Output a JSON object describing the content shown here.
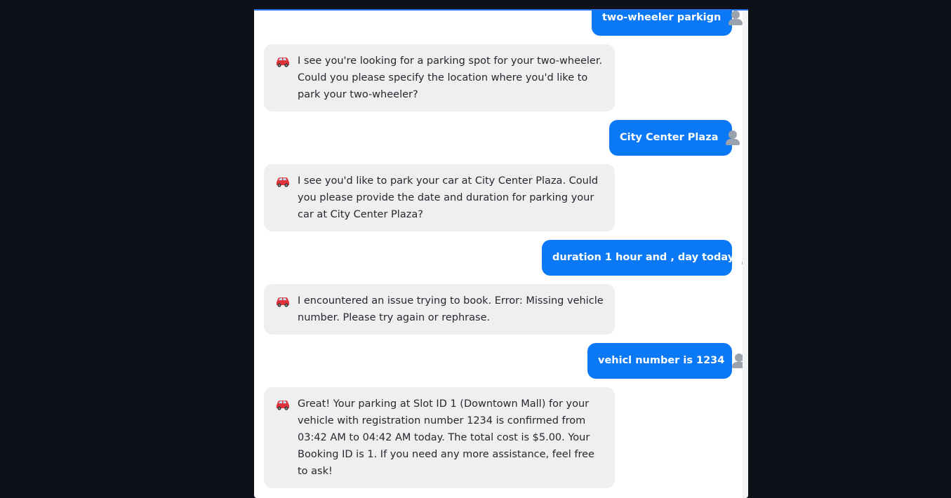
{
  "messages": [
    {
      "role": "user",
      "text": "two-wheeler parkign"
    },
    {
      "role": "bot",
      "text": "I see you're looking for a parking spot for your two-wheeler. Could you please specify the location where you'd like to park your two-wheeler?"
    },
    {
      "role": "user",
      "text": "City Center Plaza"
    },
    {
      "role": "bot",
      "text": "I see you'd like to park your car at City Center Plaza. Could you please provide the date and duration for parking your car at City Center Plaza?"
    },
    {
      "role": "user",
      "text": "duration 1 hour and , day today"
    },
    {
      "role": "bot",
      "text": "I encountered an issue trying to book. Error: Missing vehicle number. Please try again or rephrase."
    },
    {
      "role": "user",
      "text": "vehicl number is 1234"
    },
    {
      "role": "bot",
      "text": "Great! Your parking at Slot ID 1 (Downtown Mall) for your vehicle with registration number 1234 is confirmed from 03:42 AM to 04:42 AM today. The total cost is $5.00. Your Booking ID is 1. If you need any more assistance, feel free to ask!"
    }
  ],
  "icons": {
    "user_avatar": "user-avatar-icon",
    "bot_avatar": "car-icon"
  },
  "colors": {
    "background": "#0e1117",
    "panel": "#ffffff",
    "user_bubble": "#0b78f5",
    "bot_bubble": "#efefef",
    "accent_top": "#1f6fe5",
    "car_red": "#e0323a"
  }
}
